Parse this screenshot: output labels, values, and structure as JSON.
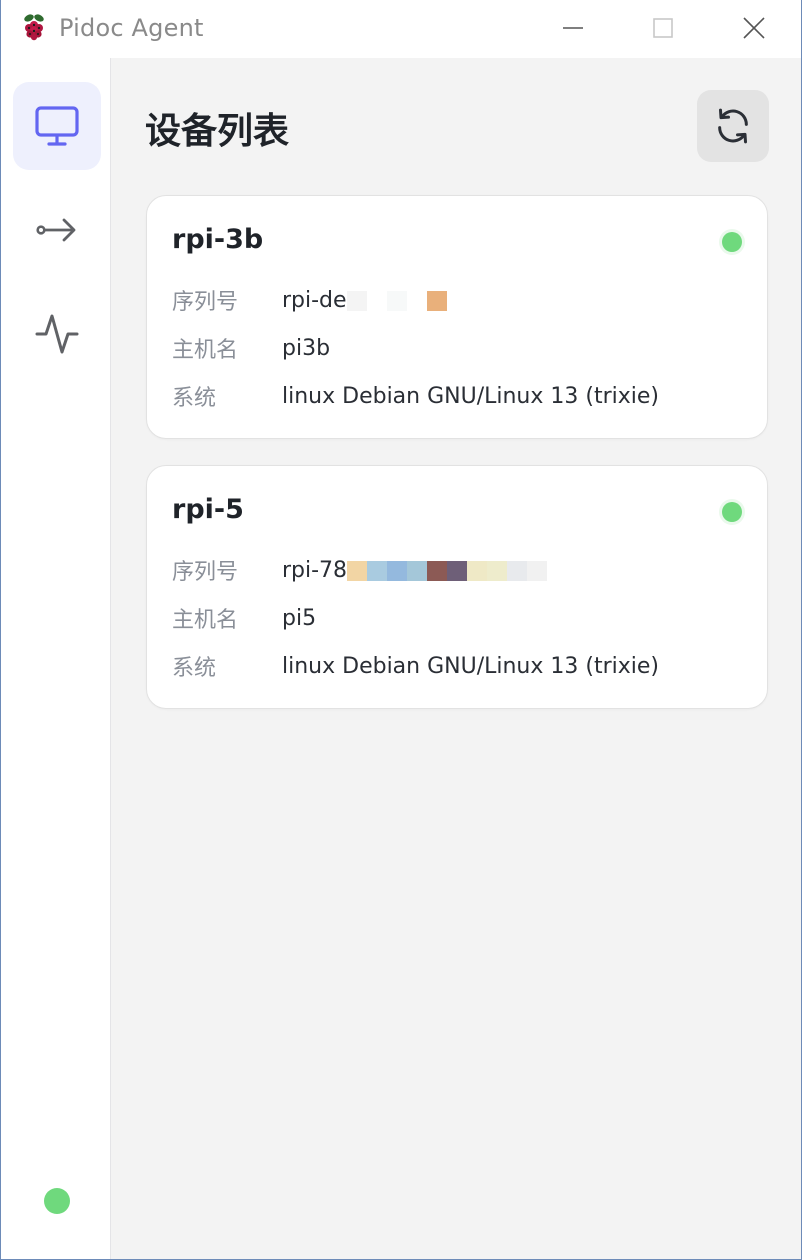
{
  "window": {
    "title": "Pidoc Agent"
  },
  "sidebar": {
    "items": [
      {
        "name": "devices",
        "icon": "monitor-icon",
        "active": true
      },
      {
        "name": "forward",
        "icon": "arrow-right-icon",
        "active": false
      },
      {
        "name": "activity",
        "icon": "activity-icon",
        "active": false
      }
    ],
    "connection_status": "connected"
  },
  "main": {
    "title": "设备列表",
    "refresh_icon": "refresh-icon"
  },
  "devices": [
    {
      "name": "rpi-3b",
      "online": true,
      "serial_label": "序列号",
      "serial_value": "rpi-de",
      "hostname_label": "主机名",
      "hostname_value": "pi3b",
      "os_label": "系统",
      "os_value": "linux Debian GNU/Linux 13 (trixie)",
      "serial_mask_colors": [
        "#f4f4f4",
        "#ffffff",
        "#f7f9f9",
        "#ffffff",
        "#e9b07b"
      ]
    },
    {
      "name": "rpi-5",
      "online": true,
      "serial_label": "序列号",
      "serial_value": "rpi-78",
      "hostname_label": "主机名",
      "hostname_value": "pi5",
      "os_label": "系统",
      "os_value": "linux Debian GNU/Linux 13 (trixie)",
      "serial_mask_colors": [
        "#f2d5a4",
        "#a9cbe0",
        "#94b9de",
        "#a4c7d9",
        "#8c5a55",
        "#6e5f78",
        "#efe9c6",
        "#eeeccc",
        "#e8eaed",
        "#f1f1f1"
      ]
    }
  ],
  "colors": {
    "accent": "#6366f1",
    "online": "#6fd97d",
    "background": "#f3f3f3"
  }
}
